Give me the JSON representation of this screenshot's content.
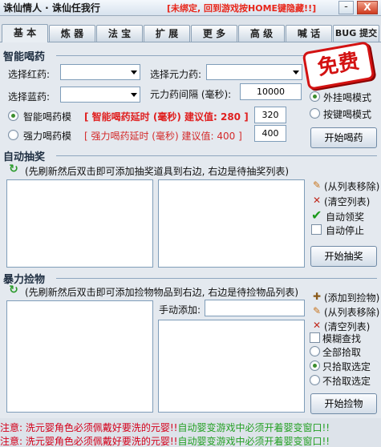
{
  "window": {
    "title": "诛仙情人 · 诛仙任我行",
    "marquee": "[未绑定, 回到游戏按HOME键隐藏!!]",
    "hide_label": "-",
    "close_label": "X"
  },
  "tabs": [
    "基 本",
    "炼 器",
    "法 宝",
    "扩 展",
    "更 多",
    "高 级",
    "喊 话",
    "BUG 提交"
  ],
  "potion": {
    "section_title": "智能喝药",
    "red_label": "选择红药:",
    "yuanli_label": "选择元力药:",
    "blue_label": "选择蓝药:",
    "interval_label": "元力药间隔 (毫秒):",
    "interval_value": "10000",
    "smart_mode_label": "智能喝药模",
    "smart_delay_text": "[ 智能喝药延时 (毫秒) 建议值: 280 ]",
    "smart_delay_value": "320",
    "force_mode_label": "强力喝药模",
    "force_delay_text": "[ 强力喝药延时 (毫秒) 建议值: 400 ]",
    "force_delay_value": "400",
    "external_mode_label": "外挂喝模式",
    "hotkey_mode_label": "按键喝模式",
    "start_button": "开始喝药",
    "promo_badge": "免费"
  },
  "lottery": {
    "section_title": "自动抽奖",
    "hint": "(先刷新然后双击即可添加抽奖道具到右边, 右边是待抽奖列表)",
    "remove_label": "(从列表移除)",
    "clear_label": "(清空列表)",
    "auto_claim_label": "自动领奖",
    "auto_stop_label": "自动停止",
    "start_button": "开始抽奖"
  },
  "pickup": {
    "section_title": "暴力捡物",
    "hint": "(先刷新然后双击即可添加捡物物品到右边, 右边是待捡物品列表)",
    "manual_add_label": "手动添加:",
    "add_label": "(添加到捡物)",
    "remove_label": "(从列表移除)",
    "clear_label": "(清空列表)",
    "fuzzy_label": "模糊查找",
    "all_label": "全部拾取",
    "only_selected_label": "只拾取选定",
    "not_selected_label": "不拾取选定",
    "start_button": "开始捡物"
  },
  "status": {
    "line1_red": "注意: 洗元婴角色必须佩戴好要洗的元婴!!",
    "line1_green": "自动婴变游戏中必须开着婴变窗口!!",
    "line2_red": "注意: 洗元婴角色必须佩戴好要洗的元婴!!",
    "line2_green": "自动婴变游戏中必须开着婴变窗口!!"
  }
}
